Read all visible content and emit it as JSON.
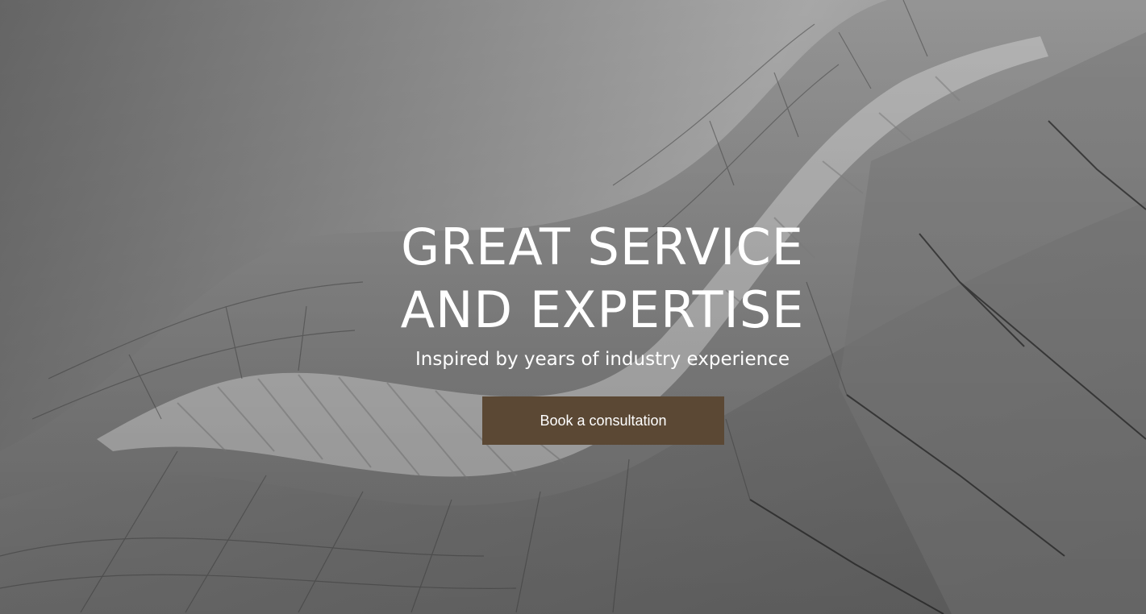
{
  "hero": {
    "background_image": "architecture-waves-grayscale",
    "headline_line1": "GREAT SERVICE",
    "headline_line2": "AND EXPERTISE",
    "subheadline": "Inspired by years of industry experience",
    "cta_label": "Book a consultation",
    "cta_color": "#5b4834"
  }
}
